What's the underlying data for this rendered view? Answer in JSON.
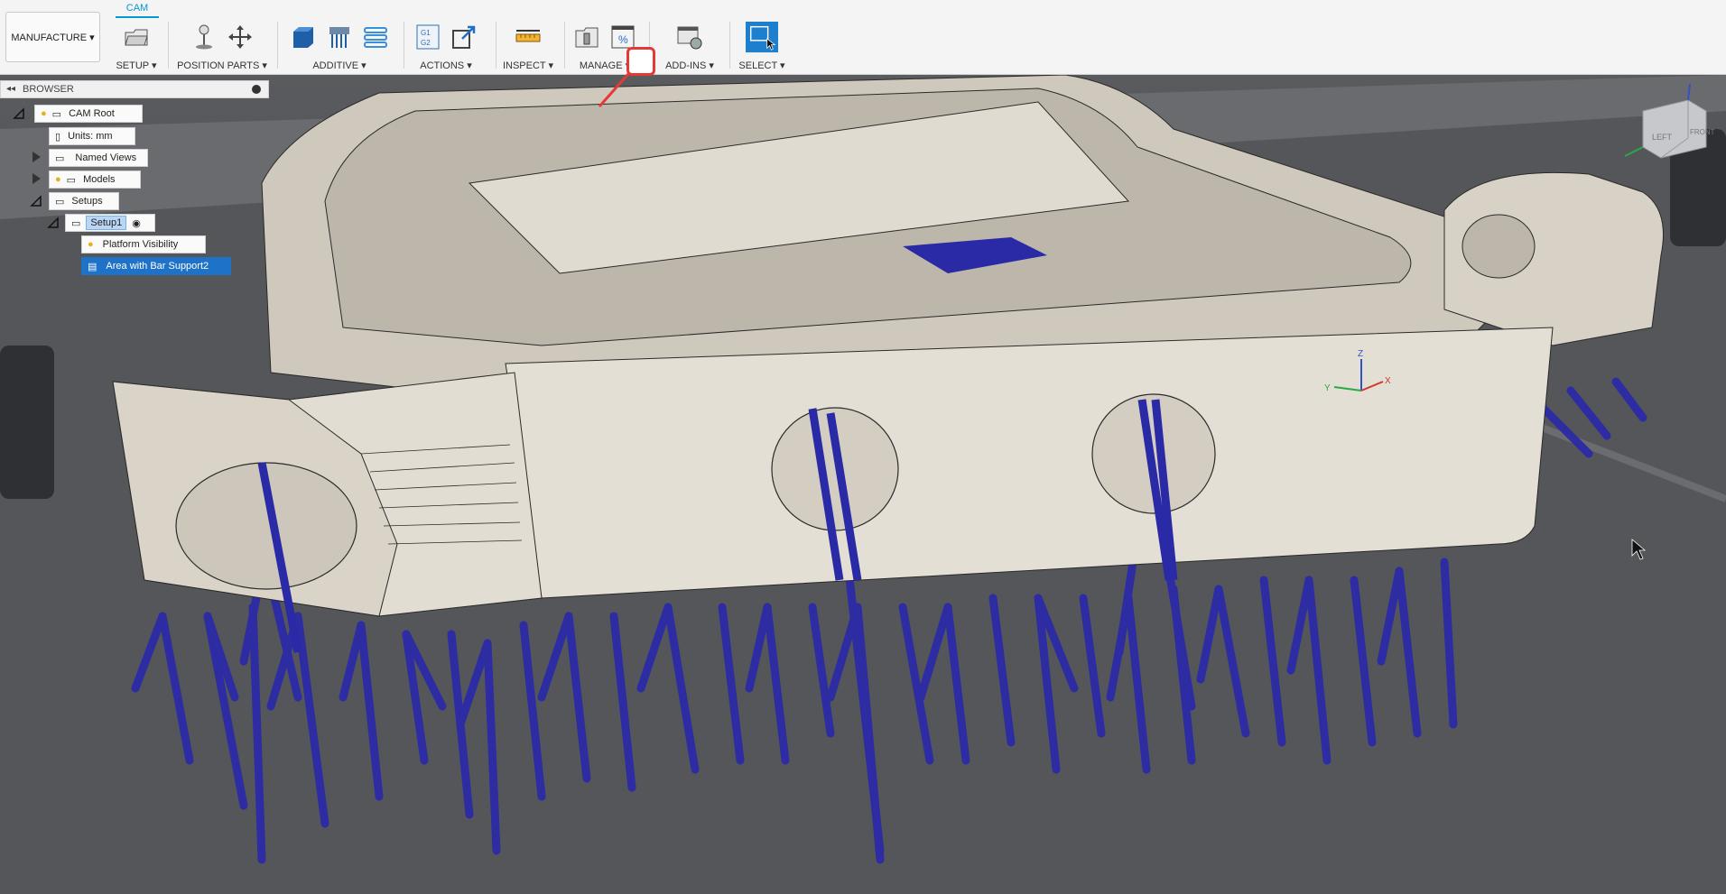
{
  "toolbar": {
    "workspace": "MANUFACTURE ▾",
    "active_tab": "CAM",
    "groups": {
      "setup": "SETUP ▾",
      "position_parts": "POSITION PARTS ▾",
      "additive": "ADDITIVE ▾",
      "actions": "ACTIONS ▾",
      "inspect": "INSPECT ▾",
      "manage": "MANAGE ▾",
      "addins": "ADD-INS ▾",
      "select": "SELECT ▾"
    },
    "actions_icon_text": "G1\nG2",
    "manage_icon_text": "%"
  },
  "browser": {
    "title": "BROWSER",
    "root": "CAM Root",
    "units": "Units: mm",
    "named_views": "Named Views",
    "models": "Models",
    "setups": "Setups",
    "setup1": "Setup1",
    "platform_visibility": "Platform Visibility",
    "area_support": "Area with Bar Support2"
  },
  "viewcube": {
    "left": "LEFT",
    "front": "FRONT"
  },
  "triad": {
    "x": "X",
    "y": "Y",
    "z": "Z"
  },
  "colors": {
    "accent": "#0696d7",
    "support": "#2b2aa6",
    "part": "#dcd7cc",
    "callout": "#e53935"
  },
  "icons": [
    "folder-setup-icon",
    "pin-icon",
    "move-arrows-icon",
    "box-icon",
    "support-bars-icon",
    "layers-icon",
    "gcode-icon",
    "export-arrow-icon",
    "ruler-icon",
    "tool-library-icon",
    "post-library-icon",
    "script-gear-icon",
    "select-cursor-icon"
  ]
}
